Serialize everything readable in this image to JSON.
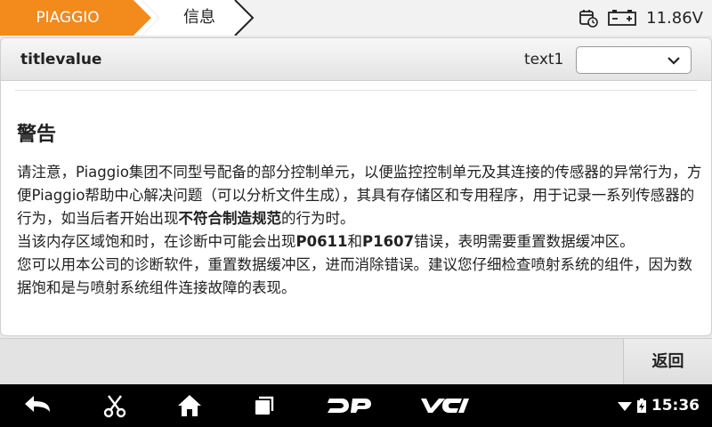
{
  "breadcrumb": {
    "brand": "PIAGGIO",
    "page": "信息"
  },
  "status": {
    "voltage": "11.86V"
  },
  "panel": {
    "title": "titlevalue",
    "select_label": "text1",
    "select_value": ""
  },
  "warning": {
    "title": "警告",
    "p1_a": "请注意，Piaggio集团不同型号配备的部分控制单元，以便监控控制单元及其连接的传感器的异常行为，方便Piaggio帮助中心解决问题（可以分析文件生成），其具有存储区和专用程序，用于记录一系列传感器的行为，如当后者开始出现",
    "p1_bold": "不符合制造规范",
    "p1_b": "的行为时。",
    "p2_a": "当该内存区域饱和时，在诊断中可能会出现",
    "p2_code1": "P0611",
    "p2_mid": "和",
    "p2_code2": "P1607",
    "p2_b": "错误，表明需要重置数据缓冲区。",
    "p3": "您可以用本公司的诊断软件，重置数据缓冲区，进而消除错误。建议您仔细检查喷射系统的组件，因为数据饱和是与喷射系统组件连接故障的表现。"
  },
  "actions": {
    "back": "返回"
  },
  "navbar": {
    "time": "15:36",
    "dp_label": "DP",
    "vci_label": "VCI"
  },
  "colors": {
    "brand_orange": "#f28a1c",
    "nav_bg": "#000000"
  }
}
